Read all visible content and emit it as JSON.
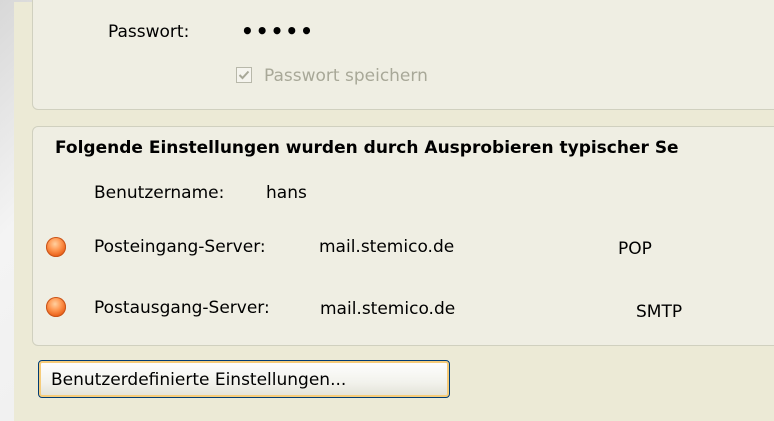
{
  "password_group": {
    "label": "Passwort:",
    "value": "•••••",
    "remember_label": "Passwort speichern",
    "remember_checked": true
  },
  "found_group": {
    "title": "Folgende Einstellungen wurden durch Ausprobieren typischer Se",
    "username_label": "Benutzername:",
    "username_value": "hans",
    "incoming": {
      "label": "Posteingang-Server:",
      "value": "mail.stemico.de",
      "protocol": "POP",
      "status_color": "#f07a30"
    },
    "outgoing": {
      "label": "Postausgang-Server:",
      "value": "mail.stemico.de",
      "protocol": "SMTP",
      "status_color": "#f07a30"
    }
  },
  "custom_settings_button": "Benutzerdefinierte Einstellungen..."
}
